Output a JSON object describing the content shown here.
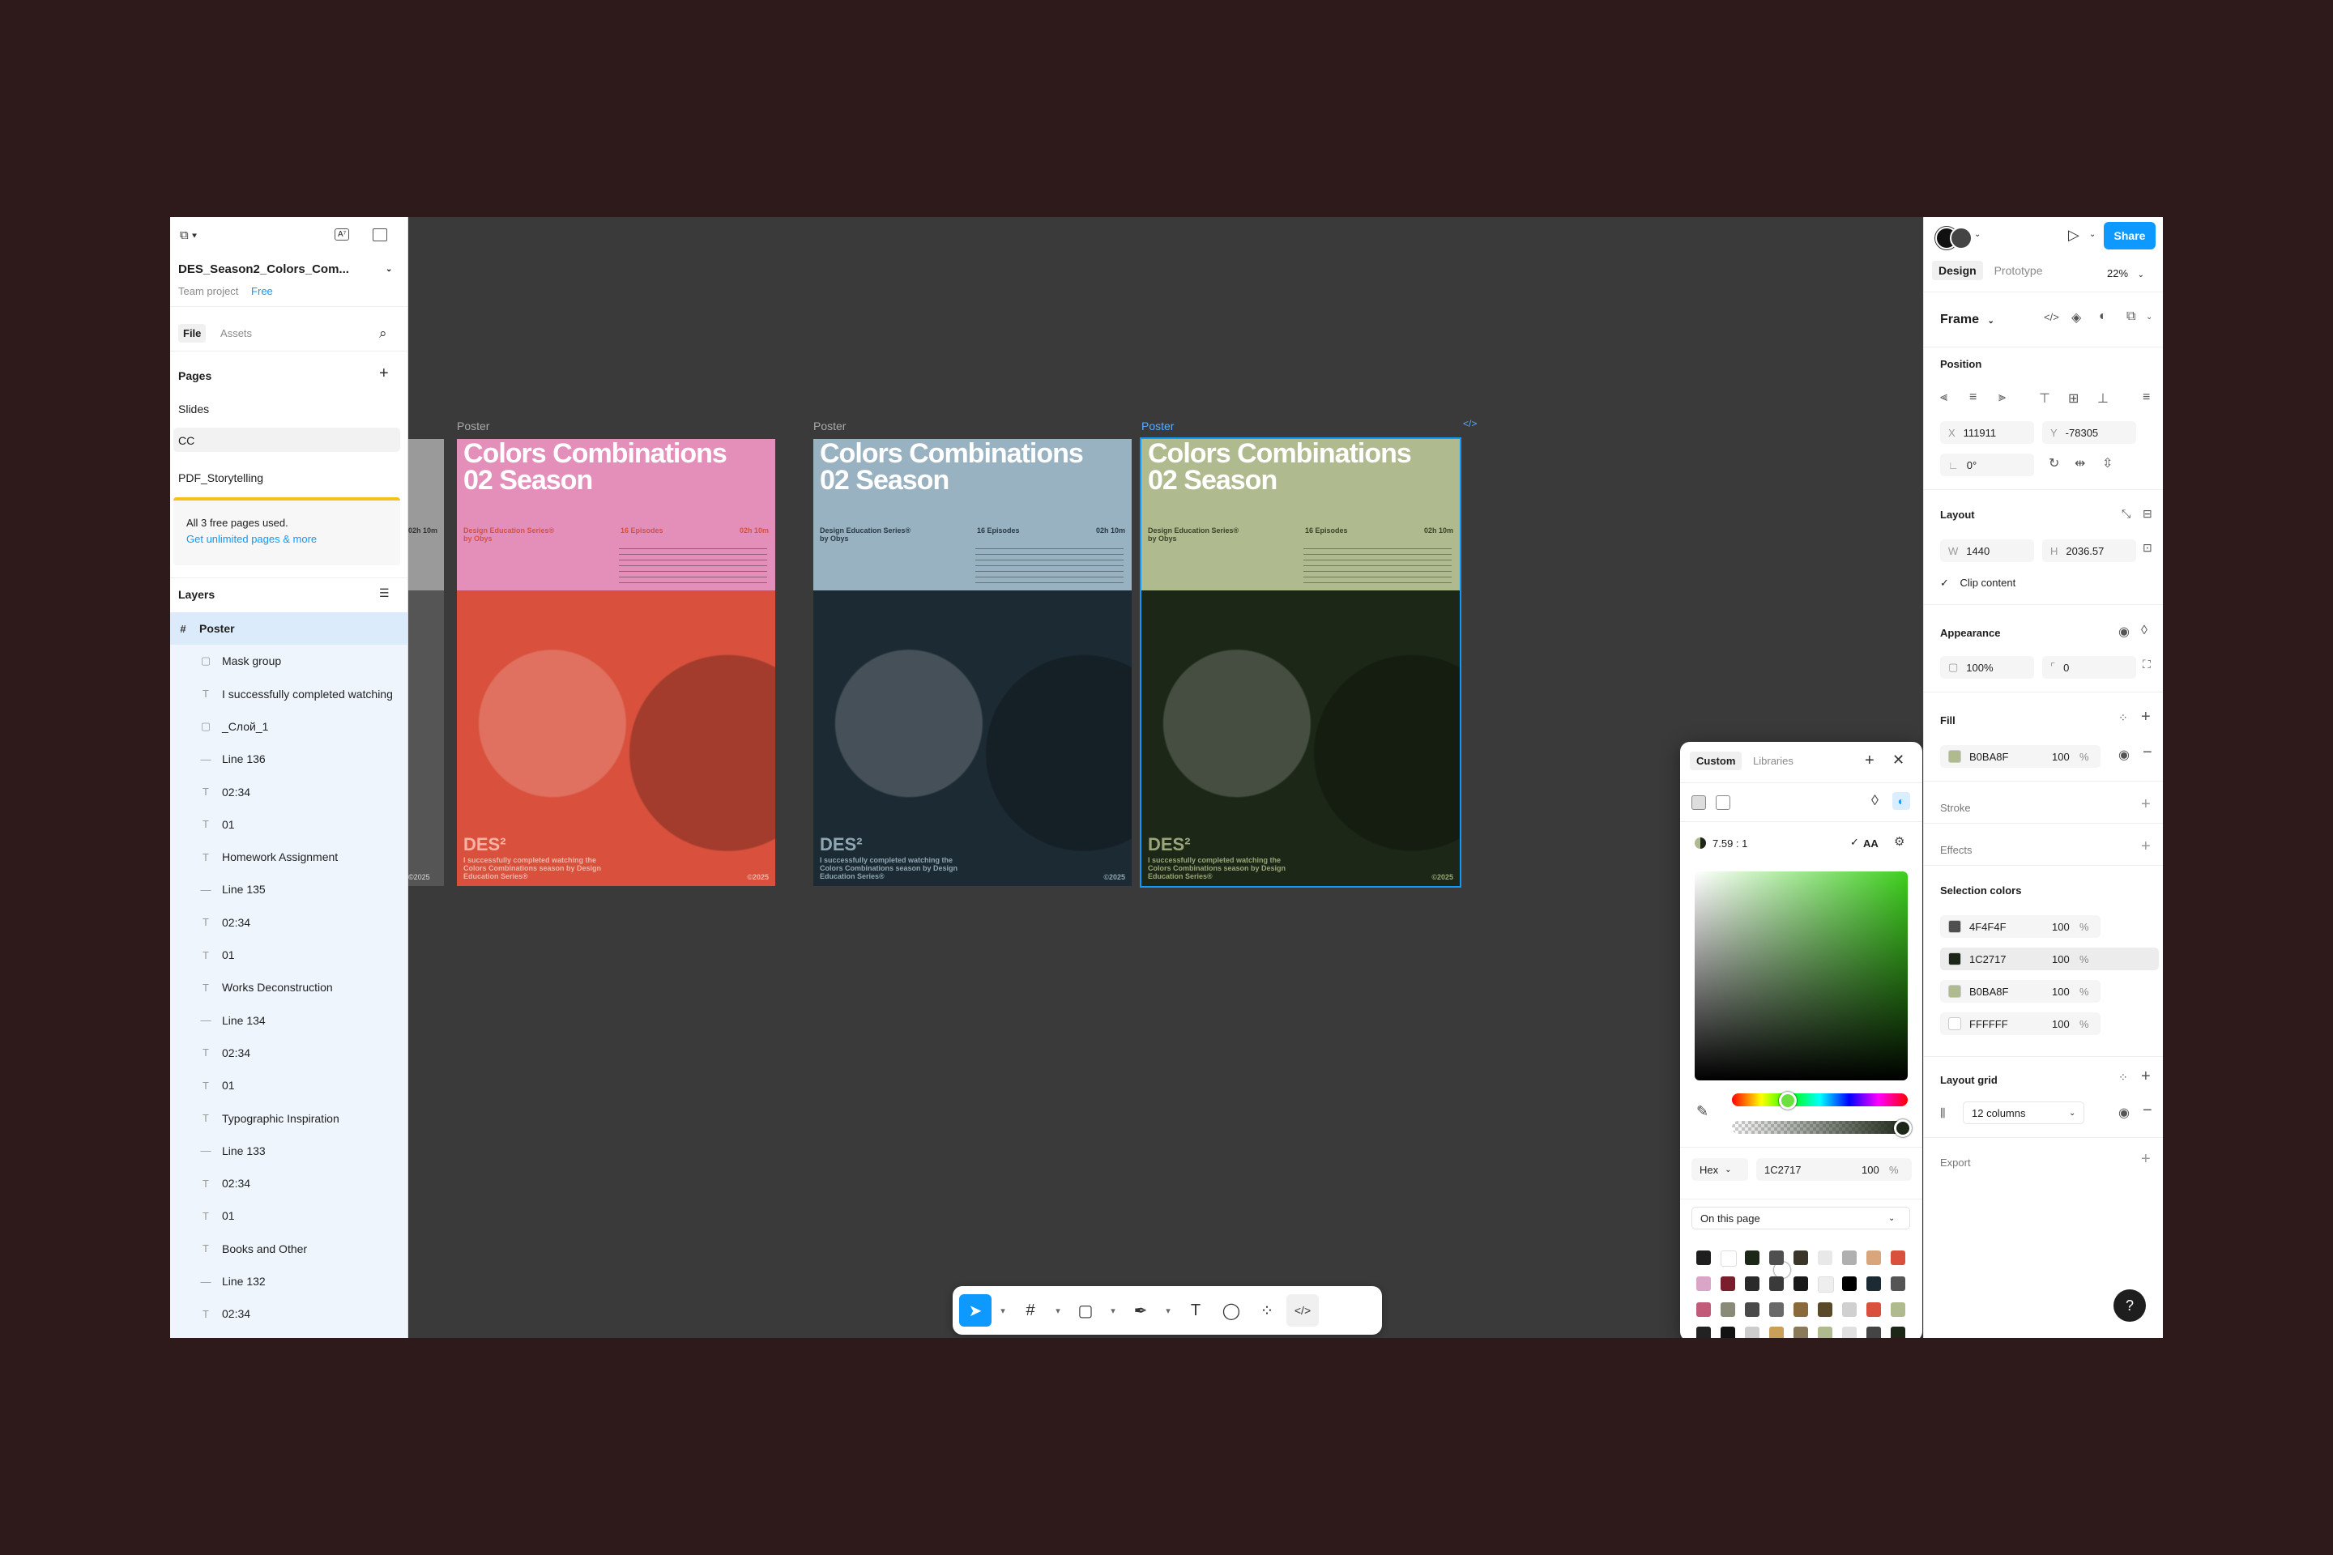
{
  "file": {
    "name": "DES_Season2_Colors_Com...",
    "team": "Team project",
    "plan": "Free"
  },
  "left_tabs": {
    "file": "File",
    "assets": "Assets"
  },
  "pages": {
    "title": "Pages",
    "items": [
      "Slides",
      "CC",
      "PDF_Storytelling"
    ]
  },
  "notice": {
    "line1": "All 3 free pages used.",
    "link": "Get unlimited pages & more"
  },
  "layers": {
    "title": "Layers",
    "items": [
      {
        "icon": "frame-icon",
        "glyph": "#",
        "label": "Poster"
      },
      {
        "icon": "mask-icon",
        "glyph": "▢",
        "label": "Mask group"
      },
      {
        "icon": "text-icon",
        "glyph": "T",
        "label": "I successfully completed watching"
      },
      {
        "icon": "image-icon",
        "glyph": "▢",
        "label": "_Слой_1"
      },
      {
        "icon": "line-icon",
        "glyph": "—",
        "label": "Line 136"
      },
      {
        "icon": "text-icon",
        "glyph": "T",
        "label": "02:34"
      },
      {
        "icon": "text-icon",
        "glyph": "T",
        "label": "01"
      },
      {
        "icon": "text-icon",
        "glyph": "T",
        "label": "Homework Assignment"
      },
      {
        "icon": "line-icon",
        "glyph": "—",
        "label": "Line 135"
      },
      {
        "icon": "text-icon",
        "glyph": "T",
        "label": "02:34"
      },
      {
        "icon": "text-icon",
        "glyph": "T",
        "label": "01"
      },
      {
        "icon": "text-icon",
        "glyph": "T",
        "label": "Works Deconstruction"
      },
      {
        "icon": "line-icon",
        "glyph": "—",
        "label": "Line 134"
      },
      {
        "icon": "text-icon",
        "glyph": "T",
        "label": "02:34"
      },
      {
        "icon": "text-icon",
        "glyph": "T",
        "label": "01"
      },
      {
        "icon": "text-icon",
        "glyph": "T",
        "label": "Typographic Inspiration"
      },
      {
        "icon": "line-icon",
        "glyph": "—",
        "label": "Line 133"
      },
      {
        "icon": "text-icon",
        "glyph": "T",
        "label": "02:34"
      },
      {
        "icon": "text-icon",
        "glyph": "T",
        "label": "01"
      },
      {
        "icon": "text-icon",
        "glyph": "T",
        "label": "Books and Other"
      },
      {
        "icon": "line-icon",
        "glyph": "—",
        "label": "Line 132"
      },
      {
        "icon": "text-icon",
        "glyph": "T",
        "label": "02:34"
      }
    ]
  },
  "posters": [
    {
      "label": "Poster",
      "title1": "Colors Combinations",
      "title2": "02 Season",
      "series": "Design Education Series®",
      "by": "by Obys",
      "episodes": "16 Episodes",
      "duration": "02h 10m",
      "des": "DES²",
      "foot": "I successfully completed watching the Colors Combinations season by Design Education Series®",
      "year": "©2025",
      "top_color": "#e48fba",
      "bottom_color": "#d9503c",
      "meta_color": "#d9503c",
      "foot_color": "#f4b3a6"
    },
    {
      "label": "Poster",
      "title1": "Colors Combinations",
      "title2": "02 Season",
      "series": "Design Education Series®",
      "by": "by Obys",
      "episodes": "16 Episodes",
      "duration": "02h 10m",
      "des": "DES²",
      "foot": "I successfully completed watching the Colors Combinations season by Design Education Series®",
      "year": "©2025",
      "top_color": "#98b2c2",
      "bottom_color": "#1c2a33",
      "meta_color": "#2a3a44",
      "foot_color": "#8fa6b3"
    },
    {
      "label": "Poster",
      "title1": "Colors Combinations",
      "title2": "02 Season",
      "series": "Design Education Series®",
      "by": "by Obys",
      "episodes": "16 Episodes",
      "duration": "02h 10m",
      "des": "DES²",
      "foot": "I successfully completed watching the Colors Combinations season by Design Education Series®",
      "year": "©2025",
      "top_color": "#b0ba8f",
      "bottom_color": "#1c2717",
      "meta_color": "#3a4428",
      "foot_color": "#9aa57a"
    }
  ],
  "partial_poster": {
    "duration": "02h 10m",
    "year": "©2025"
  },
  "right": {
    "share": "Share",
    "tabs": {
      "design": "Design",
      "prototype": "Prototype"
    },
    "zoom": "22%",
    "frame": "Frame",
    "position": {
      "title": "Position",
      "x_label": "X",
      "x": "111911",
      "y_label": "Y",
      "y": "-78305",
      "rot": "0°"
    },
    "layout": {
      "title": "Layout",
      "w_label": "W",
      "w": "1440",
      "h_label": "H",
      "h": "2036.57",
      "clip": "Clip content"
    },
    "appearance": {
      "title": "Appearance",
      "opacity": "100%",
      "radius": "0"
    },
    "fill": {
      "title": "Fill",
      "hex": "B0BA8F",
      "opacity": "100",
      "pct": "%",
      "color": "#b0ba8f"
    },
    "stroke": "Stroke",
    "effects": "Effects",
    "selection": {
      "title": "Selection colors",
      "items": [
        {
          "hex": "4F4F4F",
          "opacity": "100",
          "pct": "%",
          "color": "#4f4f4f"
        },
        {
          "hex": "1C2717",
          "opacity": "100",
          "pct": "%",
          "color": "#1c2717"
        },
        {
          "hex": "B0BA8F",
          "opacity": "100",
          "pct": "%",
          "color": "#b0ba8f"
        },
        {
          "hex": "FFFFFF",
          "opacity": "100",
          "pct": "%",
          "color": "#ffffff"
        }
      ]
    },
    "grid": {
      "title": "Layout grid",
      "value": "12 columns"
    },
    "export": "Export"
  },
  "picker": {
    "tabs": {
      "custom": "Custom",
      "libraries": "Libraries"
    },
    "contrast": "7.59 : 1",
    "aa": "AA",
    "mode": "Hex",
    "hex": "1C2717",
    "opacity": "100",
    "pct": "%",
    "scope": "On this page",
    "swatches": [
      "#1e1e1e",
      "#ffffff",
      "#1c2717",
      "#4f4f4f",
      "#3a3528",
      "#e8e8e8",
      "#b0b0b0",
      "#d9a57a",
      "#d9503c",
      "#d9a6c8",
      "#7a1e2e",
      "#2a2a2a",
      "#3a3a3a",
      "#1a1a1a",
      "#eeeeee",
      "#000000",
      "#1c2a33",
      "#555555",
      "#c25a7a",
      "#8a8a78",
      "#4a4a4a",
      "#6a6a6a",
      "#8a6a3a",
      "#5a4a2a",
      "#d0d0d0",
      "#d9503c",
      "#b0ba8f",
      "#222222",
      "#111111",
      "#cccccc",
      "#c9a05a",
      "#8a7a5a",
      "#b0ba8f",
      "#e0e0e0",
      "#444444",
      "#1c2717"
    ]
  }
}
